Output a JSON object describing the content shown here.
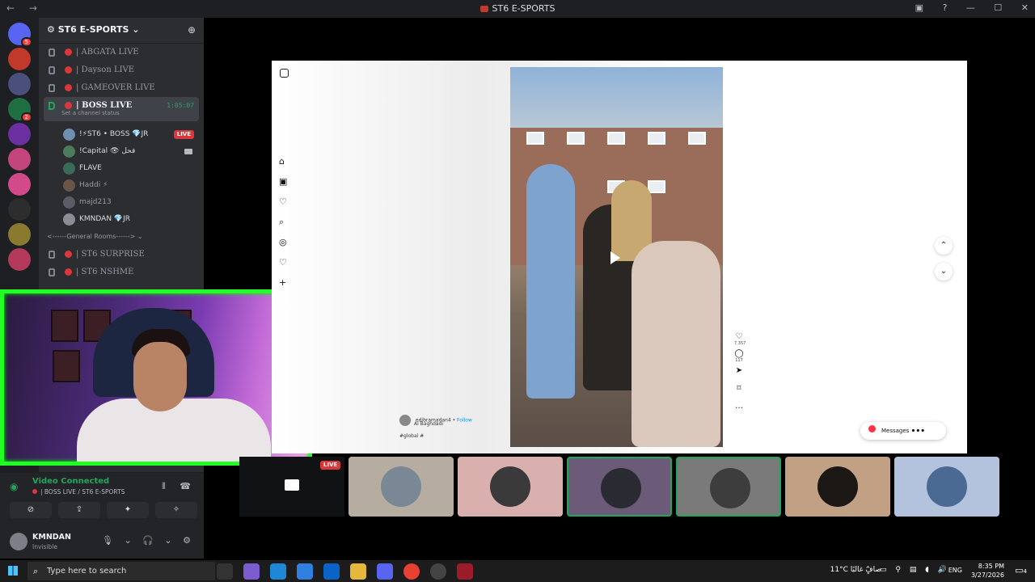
{
  "titlebar": {
    "title": "ST6 E-SPORTS",
    "back": "←",
    "forward": "→"
  },
  "servers": [
    {
      "color": "#5865f2",
      "badge": "5"
    },
    {
      "color": "#c0392b",
      "badge": ""
    },
    {
      "color": "#4a4f7c",
      "badge": ""
    },
    {
      "color": "#1f6f43",
      "badge": "2"
    },
    {
      "color": "#6b2fa0",
      "badge": ""
    },
    {
      "color": "#c2457b",
      "badge": ""
    },
    {
      "color": "#d24a8a",
      "badge": ""
    },
    {
      "color": "#2d2d2d",
      "badge": ""
    },
    {
      "color": "#8a7a30",
      "badge": ""
    },
    {
      "color": "#b33a5a",
      "badge": ""
    }
  ],
  "guild": {
    "name": "ST6 E-SPORTS"
  },
  "channels": [
    {
      "name": "| ABGATA LIVE"
    },
    {
      "name": "| Dayson LIVE"
    },
    {
      "name": "| GAMEOVER LIVE"
    }
  ],
  "active_channel": {
    "name": "| BOSS LIVE",
    "timer": "1:05:07",
    "status": "Set a channel status"
  },
  "members": [
    {
      "name": "!⚡ST6 • BOSS 💎JR",
      "live": "LIVE",
      "cam": false,
      "dim": false,
      "color": "#6f8fb0"
    },
    {
      "name": "!Capital 👁 فحل",
      "live": "",
      "cam": true,
      "dim": false,
      "color": "#4d7a58"
    },
    {
      "name": "FLAVE",
      "live": "",
      "cam": false,
      "dim": false,
      "color": "#3a6b5a"
    },
    {
      "name": "Haddi ⚡",
      "live": "",
      "cam": false,
      "dim": true,
      "color": "#6a5548"
    },
    {
      "name": "majd213",
      "live": "",
      "cam": false,
      "dim": true,
      "color": "#5a5d66"
    },
    {
      "name": "KMNDAN 💎JR",
      "live": "",
      "cam": false,
      "dim": false,
      "color": "#8a8d94"
    }
  ],
  "category": "<------General Rooms------> ⌄",
  "channels2": [
    {
      "name": "| ST6 SURPRISE"
    },
    {
      "name": "| ST6 NSHME"
    }
  ],
  "voice": {
    "status": "Video Connected",
    "sub": "| BOSS LIVE / ST6 E-SPORTS"
  },
  "user": {
    "name": "KMNDAN",
    "status": "Invisible"
  },
  "instagram": {
    "username": "edibramadan4",
    "follow": "Follow",
    "location": "Al Baghdadi",
    "hashtag": "#global #",
    "likes": "7,357",
    "comments": "117",
    "messages": "Messages"
  },
  "tiles": {
    "live": "LIVE",
    "colors": [
      "#b7aca0",
      "#d9b0ae",
      "#6b5a78",
      "#7a7a7a",
      "#c2a084",
      "#b3c3de"
    ],
    "avatar_colors": [
      "#7a8896",
      "#3a3a3a",
      "#2a2a32",
      "#3d3d3d",
      "#1a1714",
      "#4a6a94"
    ]
  },
  "taskbar": {
    "search_placeholder": "Type here to search",
    "weather": "11°C صافٍ غالبًا",
    "lang": "ENG",
    "time": "8:35 PM",
    "date": "3/27/2026",
    "notif_count": "4"
  }
}
